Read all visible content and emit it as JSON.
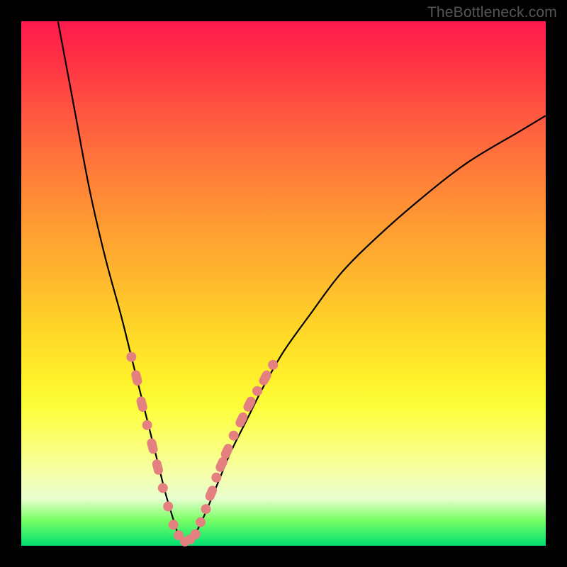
{
  "watermark": "TheBottleneck.com",
  "chart_data": {
    "type": "line",
    "title": "",
    "xlabel": "",
    "ylabel": "",
    "xlim": [
      0,
      100
    ],
    "ylim": [
      0,
      100
    ],
    "grid": false,
    "series": [
      {
        "name": "curve",
        "x": [
          7,
          10,
          13,
          16,
          19,
          21,
          23,
          24.5,
          26,
          27.5,
          29,
          30,
          31.2,
          33,
          35,
          37.5,
          40,
          43,
          46,
          50,
          55,
          61,
          68,
          76,
          85,
          95,
          100
        ],
        "y": [
          100,
          84,
          68,
          55,
          44,
          36,
          28,
          22,
          16,
          10,
          5,
          2,
          0.5,
          2,
          6,
          12,
          18,
          24,
          30,
          37,
          44,
          52,
          59,
          66,
          73,
          79,
          82
        ]
      }
    ],
    "markers_left": [
      {
        "x": 21.0,
        "y": 36.0,
        "kind": "dot"
      },
      {
        "x": 22.0,
        "y": 32.0,
        "kind": "pill"
      },
      {
        "x": 23.0,
        "y": 27.0,
        "kind": "pill"
      },
      {
        "x": 24.0,
        "y": 23.0,
        "kind": "dot"
      },
      {
        "x": 25.0,
        "y": 19.0,
        "kind": "pill"
      },
      {
        "x": 26.0,
        "y": 15.0,
        "kind": "pill"
      },
      {
        "x": 27.0,
        "y": 11.0,
        "kind": "dot"
      },
      {
        "x": 28.0,
        "y": 7.5,
        "kind": "dot"
      }
    ],
    "markers_bottom": [
      {
        "x": 29.0,
        "y": 4.0,
        "kind": "dot"
      },
      {
        "x": 30.0,
        "y": 2.0,
        "kind": "dot"
      },
      {
        "x": 31.2,
        "y": 0.8,
        "kind": "dot"
      },
      {
        "x": 32.2,
        "y": 1.2,
        "kind": "dot"
      },
      {
        "x": 33.2,
        "y": 2.2,
        "kind": "dot"
      }
    ],
    "markers_right": [
      {
        "x": 34.2,
        "y": 4.5,
        "kind": "dot"
      },
      {
        "x": 35.2,
        "y": 7.0,
        "kind": "dot"
      },
      {
        "x": 36.2,
        "y": 10.0,
        "kind": "pill"
      },
      {
        "x": 37.2,
        "y": 13.0,
        "kind": "dot"
      },
      {
        "x": 38.2,
        "y": 15.5,
        "kind": "pill"
      },
      {
        "x": 39.2,
        "y": 18.0,
        "kind": "pill"
      },
      {
        "x": 40.5,
        "y": 21.0,
        "kind": "dot"
      },
      {
        "x": 42.0,
        "y": 24.0,
        "kind": "pill"
      },
      {
        "x": 43.5,
        "y": 27.0,
        "kind": "pill"
      },
      {
        "x": 45.0,
        "y": 29.5,
        "kind": "dot"
      },
      {
        "x": 46.5,
        "y": 32.0,
        "kind": "pill"
      },
      {
        "x": 48.0,
        "y": 34.5,
        "kind": "dot"
      }
    ],
    "background_gradient": {
      "top": "#ff1a4d",
      "mid_upper": "#ff9933",
      "mid_lower": "#fff02a",
      "bottom": "#00e070"
    }
  }
}
